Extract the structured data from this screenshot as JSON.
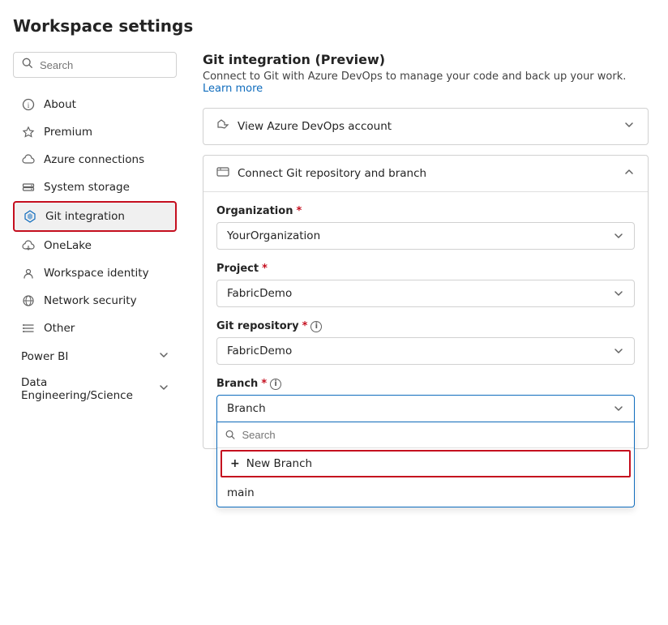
{
  "page": {
    "title": "Workspace settings"
  },
  "search": {
    "placeholder": "Search"
  },
  "sidebar": {
    "items": [
      {
        "id": "about",
        "label": "About",
        "icon": "info"
      },
      {
        "id": "premium",
        "label": "Premium",
        "icon": "diamond"
      },
      {
        "id": "azure-connections",
        "label": "Azure connections",
        "icon": "cloud"
      },
      {
        "id": "system-storage",
        "label": "System storage",
        "icon": "storage"
      },
      {
        "id": "git-integration",
        "label": "Git integration",
        "icon": "git",
        "active": true
      },
      {
        "id": "onelake",
        "label": "OneLake",
        "icon": "lake"
      },
      {
        "id": "workspace-identity",
        "label": "Workspace identity",
        "icon": "identity"
      },
      {
        "id": "network-security",
        "label": "Network security",
        "icon": "network"
      },
      {
        "id": "other",
        "label": "Other",
        "icon": "other"
      }
    ],
    "sections": [
      {
        "id": "power-bi",
        "label": "Power BI",
        "collapsed": true
      },
      {
        "id": "data-engineering",
        "label": "Data Engineering/Science",
        "collapsed": true
      }
    ]
  },
  "main": {
    "section_title": "Git integration (Preview)",
    "section_desc": "Connect to Git with Azure DevOps to manage your code and back up your work.",
    "learn_more": "Learn more",
    "view_azure": "View Azure DevOps account",
    "connect_panel": {
      "title": "Connect Git repository and branch",
      "fields": {
        "organization": {
          "label": "Organization",
          "required": true,
          "value": "YourOrganization"
        },
        "project": {
          "label": "Project",
          "required": true,
          "value": "FabricDemo"
        },
        "git_repository": {
          "label": "Git repository",
          "required": true,
          "has_info": true,
          "value": "FabricDemo"
        },
        "branch": {
          "label": "Branch",
          "required": true,
          "has_info": true,
          "value": "Branch",
          "open": true,
          "dropdown_search_placeholder": "Search",
          "dropdown_items": [
            {
              "id": "new-branch",
              "label": "New Branch",
              "type": "new"
            },
            {
              "id": "main",
              "label": "main",
              "type": "existing"
            }
          ]
        }
      }
    }
  }
}
